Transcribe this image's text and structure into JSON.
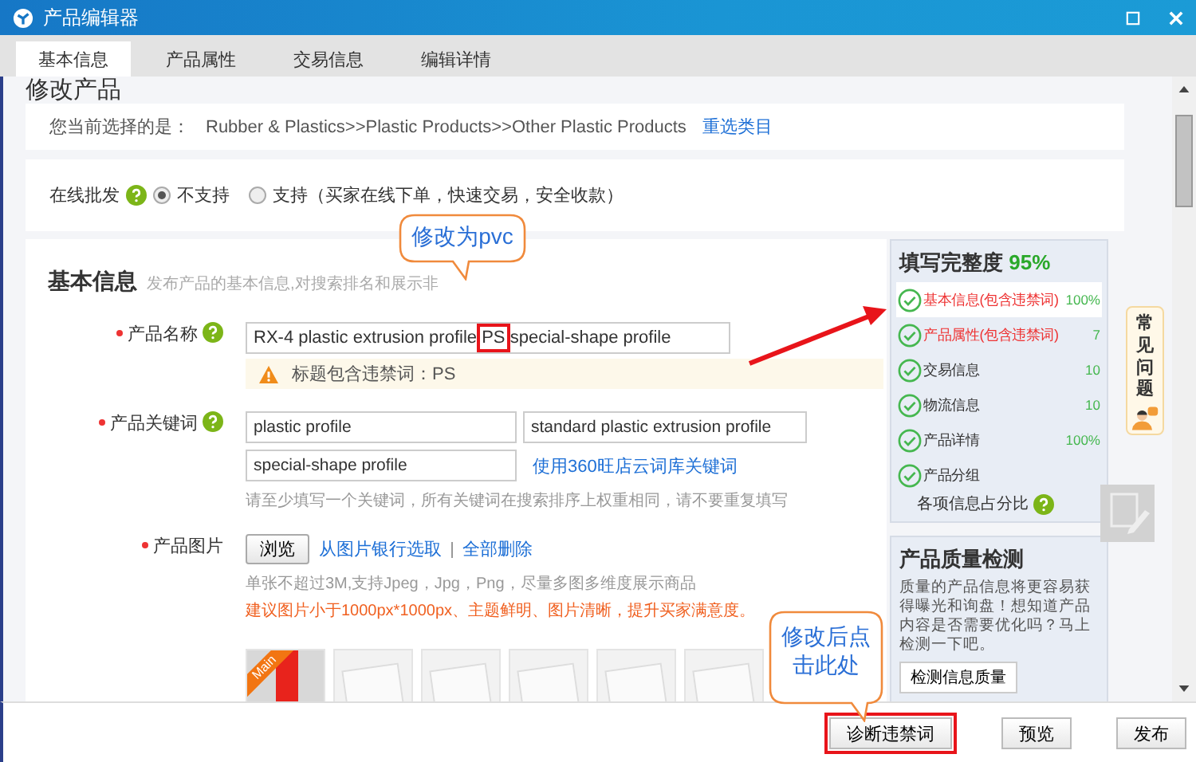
{
  "window": {
    "title": "产品编辑器"
  },
  "tabs": [
    {
      "label": "基本信息",
      "selected": true
    },
    {
      "label": "产品属性",
      "selected": false
    },
    {
      "label": "交易信息",
      "selected": false
    },
    {
      "label": "编辑详情",
      "selected": false
    }
  ],
  "page_title": "修改产品",
  "category": {
    "label": "您当前选择的是：",
    "path": "Rubber & Plastics>>Plastic Products>>Other Plastic Products",
    "link": "重选类目"
  },
  "wholesale": {
    "label": "在线批发",
    "options": [
      {
        "label": "不支持",
        "selected": true
      },
      {
        "label": "支持（买家在线下单，快速交易，安全收款）",
        "selected": false
      }
    ]
  },
  "basic": {
    "title": "基本信息",
    "description": "发布产品的基本信息,对搜索排名和展示非",
    "name_field": {
      "label": "产品名称",
      "value_before": "RX-4 plastic extrusion profile",
      "highlight": "PS",
      "value_after": "special-shape profile",
      "warning": "标题包含违禁词：PS"
    },
    "keywords": {
      "label": "产品关键词",
      "values": [
        "plastic profile",
        "standard plastic extrusion profile",
        "special-shape profile"
      ],
      "link": "使用360旺店云词库关键词",
      "hint": "请至少填写一个关键词，所有关键词在搜索排序上权重相同，请不要重复填写"
    },
    "images": {
      "label": "产品图片",
      "browse": "浏览",
      "links": [
        "从图片银行选取",
        "全部删除"
      ],
      "hint": "单张不超过3M,支持Jpeg，Jpg，Png，尽量多图多维度展示商品",
      "advice": "建议图片小于1000px*1000px、主题鲜明、图片清晰，提升买家满意度。",
      "main_badge": "Main",
      "thumbnails": [
        {
          "kind": "photo"
        },
        {
          "kind": "empty"
        },
        {
          "kind": "empty"
        },
        {
          "kind": "empty"
        },
        {
          "kind": "empty"
        },
        {
          "kind": "empty"
        }
      ]
    }
  },
  "completeness": {
    "title": "填写完整度",
    "percent": "95%",
    "items": [
      {
        "label": "基本信息(包含违禁词)",
        "percent": "100%",
        "warning": true,
        "selected": true
      },
      {
        "label": "产品属性(包含违禁词)",
        "percent": "7",
        "warning": true,
        "selected": false
      },
      {
        "label": "交易信息",
        "percent": "10",
        "warning": false,
        "selected": false
      },
      {
        "label": "物流信息",
        "percent": "10",
        "warning": false,
        "selected": false
      },
      {
        "label": "产品详情",
        "percent": "100%",
        "warning": false,
        "selected": false
      },
      {
        "label": "产品分组",
        "warning": false,
        "selected": false
      }
    ],
    "footer": "各项信息占分比"
  },
  "quality": {
    "title": "产品质量检测",
    "text": "质量的产品信息将更容易获得曝光和询盘！想知道产品内容是否需要优化吗？马上检测一下吧。",
    "button": "检测信息质量"
  },
  "help_tab": "常见问题",
  "callouts": [
    {
      "text": "修改为pvc"
    },
    {
      "text": "修改后点击此处"
    }
  ],
  "footer_buttons": [
    {
      "label": "诊断违禁词",
      "highlighted": true
    },
    {
      "label": "预览",
      "highlighted": false
    },
    {
      "label": "发布",
      "highlighted": false
    }
  ]
}
